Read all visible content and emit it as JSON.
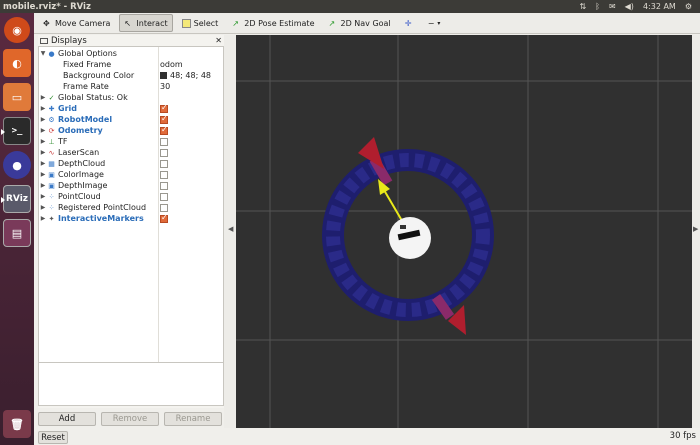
{
  "window": {
    "title": "mobile.rviz* - RViz"
  },
  "tray": {
    "time": "4:32 AM"
  },
  "toolbar": {
    "move_camera": "Move Camera",
    "interact": "Interact",
    "select": "Select",
    "pose_estimate": "2D Pose Estimate",
    "nav_goal": "2D Nav Goal"
  },
  "displays": {
    "header": "Displays",
    "global_options": "Global Options",
    "fixed_frame_label": "Fixed Frame",
    "fixed_frame_value": "odom",
    "bg_color_label": "Background Color",
    "bg_color_value": "48; 48; 48",
    "frame_rate_label": "Frame Rate",
    "frame_rate_value": "30",
    "global_status": "Global Status: Ok",
    "items": [
      {
        "label": "Grid",
        "checked": true,
        "bold": true,
        "icon": "grid-icon"
      },
      {
        "label": "RobotModel",
        "checked": true,
        "bold": true,
        "icon": "robot-icon"
      },
      {
        "label": "Odometry",
        "checked": true,
        "bold": true,
        "icon": "odometry-icon"
      },
      {
        "label": "TF",
        "checked": false,
        "bold": false,
        "icon": "tf-icon"
      },
      {
        "label": "LaserScan",
        "checked": false,
        "bold": false,
        "icon": "laser-icon"
      },
      {
        "label": "DepthCloud",
        "checked": false,
        "bold": false,
        "icon": "cloud-icon"
      },
      {
        "label": "ColorImage",
        "checked": false,
        "bold": false,
        "icon": "image-icon"
      },
      {
        "label": "DepthImage",
        "checked": false,
        "bold": false,
        "icon": "image-icon"
      },
      {
        "label": "PointCloud",
        "checked": false,
        "bold": false,
        "icon": "pointcloud-icon"
      },
      {
        "label": "Registered PointCloud",
        "checked": false,
        "bold": false,
        "icon": "pointcloud-icon"
      },
      {
        "label": "InteractiveMarkers",
        "checked": true,
        "bold": true,
        "icon": "marker-icon"
      }
    ]
  },
  "panel_buttons": {
    "add": "Add",
    "remove": "Remove",
    "rename": "Rename"
  },
  "footer": {
    "reset": "Reset",
    "fps": "30 fps"
  },
  "colors": {
    "view_background": "#303030",
    "accent": "#2a6cb8",
    "check": "#e06a3a"
  }
}
